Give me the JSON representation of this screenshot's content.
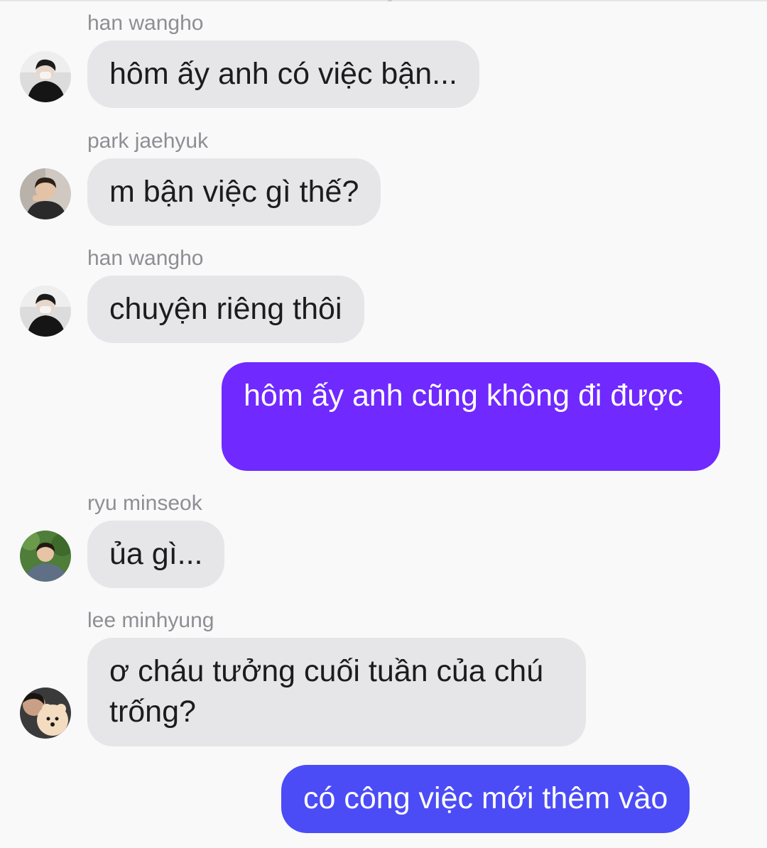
{
  "messages": [
    {
      "sender": "han wangho",
      "text": "hôm ấy anh có việc bận...",
      "avatar": "avatar-han-wangho"
    },
    {
      "sender": "park jaehyuk",
      "text": "m bận việc gì thế?",
      "avatar": "avatar-park-jaehyuk"
    },
    {
      "sender": "han wangho",
      "text": "chuyện riêng thôi",
      "avatar": "avatar-han-wangho"
    },
    {
      "outgoing": true,
      "text": "hôm ấy anh cũng không đi được"
    },
    {
      "sender": "ryu minseok",
      "text": "ủa gì...",
      "avatar": "avatar-ryu-minseok"
    },
    {
      "sender": "lee minhyung",
      "text": "ơ cháu tưởng cuối tuần của chú trống?",
      "avatar": "avatar-lee-minhyung"
    },
    {
      "outgoing": true,
      "text": "có công việc mới thêm vào"
    }
  ],
  "colors": {
    "background": "#f9f9fa",
    "incoming_bubble": "#e6e6e9",
    "outgoing_gradient_top": "#7029ff",
    "outgoing_gradient_bottom": "#4b4cf6",
    "sender_name": "#8e8e93"
  }
}
